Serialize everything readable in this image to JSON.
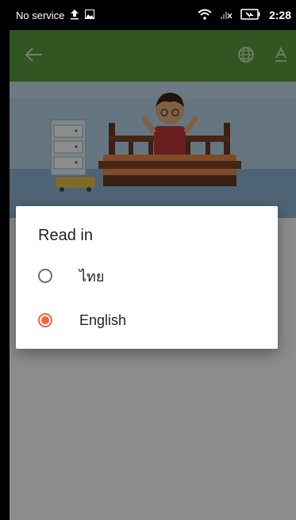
{
  "status_bar": {
    "carrier": "No service",
    "time": "2:28",
    "icons": [
      "upload-icon",
      "image-icon",
      "wifi-icon",
      "no-signal-icon",
      "battery-charging-icon"
    ]
  },
  "app_bar": {
    "icons": [
      "back-arrow-icon",
      "globe-icon",
      "text-size-icon"
    ]
  },
  "dialog": {
    "title": "Read in",
    "options": [
      {
        "label": "ไทย",
        "selected": false
      },
      {
        "label": "English",
        "selected": true
      }
    ]
  },
  "colors": {
    "app_bar": "#5c9d3c",
    "accent": "#f0643a"
  }
}
